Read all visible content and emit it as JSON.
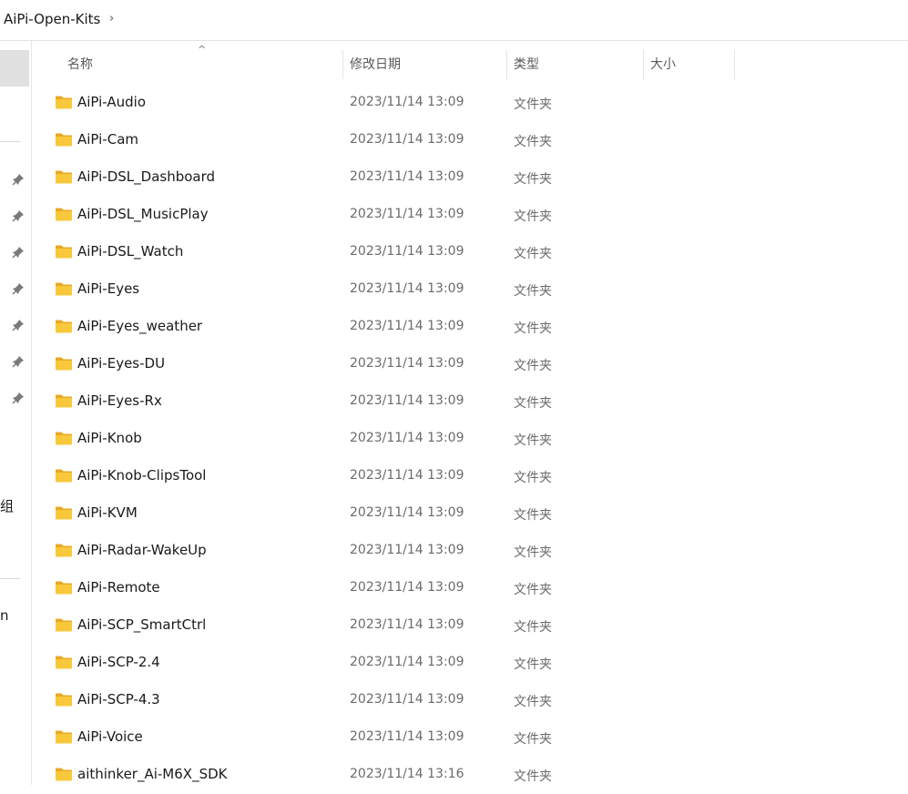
{
  "breadcrumb": {
    "current": "AiPi-Open-Kits",
    "chevron": "›"
  },
  "nav": {
    "partial_labels": [
      "组",
      "n"
    ]
  },
  "columns": {
    "name": "名称",
    "date": "修改日期",
    "type": "类型",
    "size": "大小",
    "sort_indicator": "^"
  },
  "files": [
    {
      "name": "AiPi-Audio",
      "date": "2023/11/14 13:09",
      "type": "文件夹"
    },
    {
      "name": "AiPi-Cam",
      "date": "2023/11/14 13:09",
      "type": "文件夹"
    },
    {
      "name": "AiPi-DSL_Dashboard",
      "date": "2023/11/14 13:09",
      "type": "文件夹"
    },
    {
      "name": "AiPi-DSL_MusicPlay",
      "date": "2023/11/14 13:09",
      "type": "文件夹"
    },
    {
      "name": "AiPi-DSL_Watch",
      "date": "2023/11/14 13:09",
      "type": "文件夹"
    },
    {
      "name": "AiPi-Eyes",
      "date": "2023/11/14 13:09",
      "type": "文件夹"
    },
    {
      "name": "AiPi-Eyes_weather",
      "date": "2023/11/14 13:09",
      "type": "文件夹"
    },
    {
      "name": "AiPi-Eyes-DU",
      "date": "2023/11/14 13:09",
      "type": "文件夹"
    },
    {
      "name": "AiPi-Eyes-Rx",
      "date": "2023/11/14 13:09",
      "type": "文件夹"
    },
    {
      "name": "AiPi-Knob",
      "date": "2023/11/14 13:09",
      "type": "文件夹"
    },
    {
      "name": "AiPi-Knob-ClipsTool",
      "date": "2023/11/14 13:09",
      "type": "文件夹"
    },
    {
      "name": "AiPi-KVM",
      "date": "2023/11/14 13:09",
      "type": "文件夹"
    },
    {
      "name": "AiPi-Radar-WakeUp",
      "date": "2023/11/14 13:09",
      "type": "文件夹"
    },
    {
      "name": "AiPi-Remote",
      "date": "2023/11/14 13:09",
      "type": "文件夹"
    },
    {
      "name": "AiPi-SCP_SmartCtrl",
      "date": "2023/11/14 13:09",
      "type": "文件夹"
    },
    {
      "name": "AiPi-SCP-2.4",
      "date": "2023/11/14 13:09",
      "type": "文件夹"
    },
    {
      "name": "AiPi-SCP-4.3",
      "date": "2023/11/14 13:09",
      "type": "文件夹"
    },
    {
      "name": "AiPi-Voice",
      "date": "2023/11/14 13:09",
      "type": "文件夹"
    },
    {
      "name": "aithinker_Ai-M6X_SDK",
      "date": "2023/11/14 13:16",
      "type": "文件夹"
    }
  ],
  "icons": {
    "folder": "folder-icon",
    "pin": "pin-icon"
  },
  "colors": {
    "folder_body": "#f8c83c",
    "folder_tab": "#e9a825",
    "nav_selected": "#e0e0e0"
  }
}
